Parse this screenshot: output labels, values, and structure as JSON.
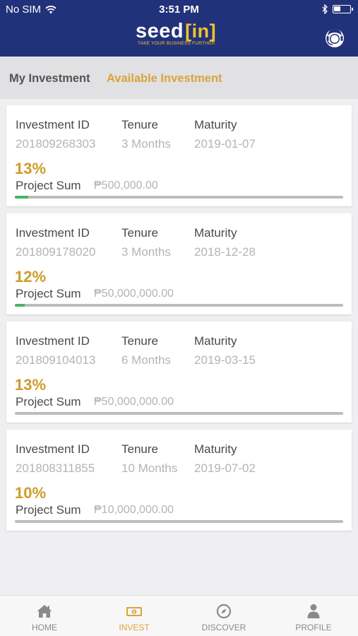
{
  "status_bar": {
    "carrier": "No SIM",
    "time": "3:51 PM"
  },
  "header": {
    "logo_main": "seed",
    "logo_in": "[in]",
    "tagline": "TAKE YOUR BUSINESS FURTHER",
    "support_icon": "support-agent-icon"
  },
  "tabs": [
    {
      "label": "My Investment",
      "active": false
    },
    {
      "label": "Available Investment",
      "active": true
    }
  ],
  "column_labels": {
    "id": "Investment  ID",
    "tenure": "Tenure",
    "maturity": "Maturity",
    "sum": "Project Sum"
  },
  "investments": [
    {
      "id": "201809268303",
      "tenure": "3 Months",
      "maturity": "2019-01-07",
      "rate": "13%",
      "sum": "₱500,000.00",
      "progress": 0.04
    },
    {
      "id": "201809178020",
      "tenure": "3 Months",
      "maturity": "2018-12-28",
      "rate": "12%",
      "sum": "₱50,000,000.00",
      "progress": 0.03
    },
    {
      "id": "201809104013",
      "tenure": "6 Months",
      "maturity": "2019-03-15",
      "rate": "13%",
      "sum": "₱50,000,000.00",
      "progress": 0
    },
    {
      "id": "201808311855",
      "tenure": "10 Months",
      "maturity": "2019-07-02",
      "rate": "10%",
      "sum": "₱10,000,000.00",
      "progress": 0
    }
  ],
  "bottom_nav": [
    {
      "label": "HOME",
      "icon": "home-icon",
      "active": false
    },
    {
      "label": "INVEST",
      "icon": "money-icon",
      "active": true
    },
    {
      "label": "DISCOVER",
      "icon": "compass-icon",
      "active": false
    },
    {
      "label": "PROFILE",
      "icon": "person-icon",
      "active": false
    }
  ],
  "colors": {
    "header": "#22327a",
    "accent": "#d9a43a",
    "progress": "#46b464"
  }
}
